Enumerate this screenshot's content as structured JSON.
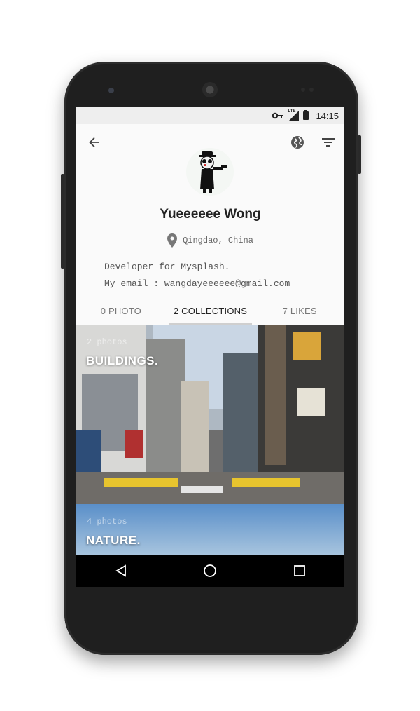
{
  "status_bar": {
    "time": "14:15",
    "network": "LTE"
  },
  "profile": {
    "name": "Yueeeeee Wong",
    "location": "Qingdao, China",
    "bio_lines": [
      "Developer for Mysplash.",
      "My email : wangdayeeeeee@gmail.com"
    ]
  },
  "tabs": [
    {
      "label": "0 PHOTO",
      "active": false
    },
    {
      "label": "2 COLLECTIONS",
      "active": true
    },
    {
      "label": "7 LIKES",
      "active": false
    }
  ],
  "collections": [
    {
      "count": "2 photos",
      "title": "BUILDINGS."
    },
    {
      "count": "4 photos",
      "title": "NATURE."
    }
  ],
  "icons": {
    "back": "arrow-left-icon",
    "web": "globe-icon",
    "filter": "filter-icon",
    "location": "location-pin-icon"
  },
  "colors": {
    "screen_bg": "#fafafa",
    "status_bg": "#eeeeee",
    "nav_bg": "#000000"
  }
}
